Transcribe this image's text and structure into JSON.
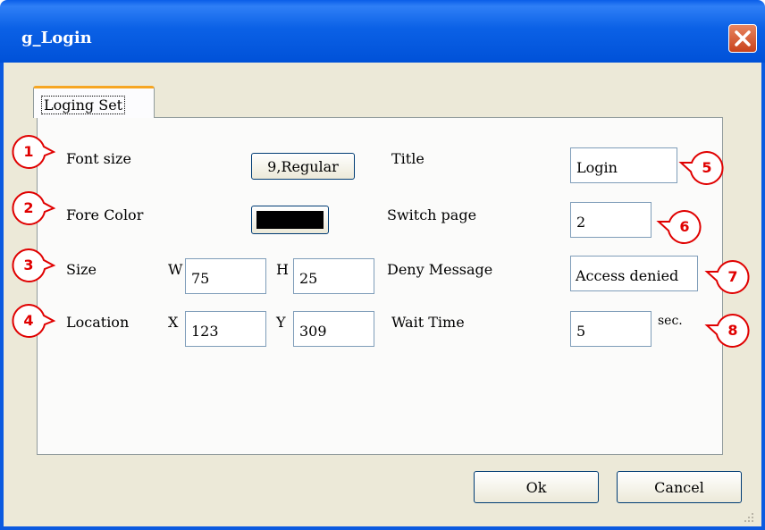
{
  "window": {
    "title": "g_Login"
  },
  "tab": {
    "label": "Loging Set"
  },
  "left": {
    "font_size_label": "Font size",
    "font_button": "9,Regular",
    "fore_color_label": "Fore Color",
    "fore_color_value": "#000000",
    "size_label": "Size",
    "w_label": "W",
    "w_value": "75",
    "h_label": "H",
    "h_value": "25",
    "location_label": "Location",
    "x_label": "X",
    "x_value": "123",
    "y_label": "Y",
    "y_value": "309"
  },
  "right": {
    "title_label": "Title",
    "title_value": "Login",
    "switch_label": "Switch page",
    "switch_value": "2",
    "deny_label": "Deny Message",
    "deny_value": "Access denied",
    "wait_label": "Wait Time",
    "wait_value": "5",
    "wait_unit": "sec."
  },
  "callouts": [
    "1",
    "2",
    "3",
    "4",
    "5",
    "6",
    "7",
    "8"
  ],
  "buttons": {
    "ok": "Ok",
    "cancel": "Cancel"
  },
  "colors": {
    "titlebar": "#0a5ee8",
    "callout": "#e00000",
    "tab_accent": "#f6a623"
  }
}
